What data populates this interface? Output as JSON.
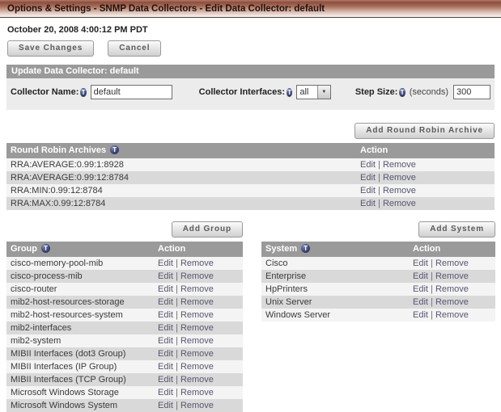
{
  "banner": {
    "title": "Options & Settings - SNMP Data Collectors - Edit Data Collector: default"
  },
  "timestamp": "October 20, 2008 4:00:12 PM PDT",
  "actions_bar": {
    "save": "Save Changes",
    "cancel": "Cancel"
  },
  "icons": {
    "tooltip_glyph": "T",
    "dropdown_arrow": "▼"
  },
  "update_form": {
    "title": "Update Data Collector: default",
    "fields": {
      "collector_name": {
        "label": "Collector Name:",
        "value": "default"
      },
      "collector_interfaces": {
        "label": "Collector Interfaces:",
        "selected": "all"
      },
      "step_size": {
        "label": "Step Size:",
        "unit": "(seconds)",
        "value": "300"
      }
    }
  },
  "row_actions": {
    "edit": "Edit",
    "remove": "Remove",
    "separator": "|"
  },
  "rra": {
    "add_button": "Add Round Robin Archive",
    "column_headers": {
      "name": "Round Robin Archives",
      "action": "Action"
    },
    "rows": [
      "RRA:AVERAGE:0.99:1:8928",
      "RRA:AVERAGE:0.99:12:8784",
      "RRA:MIN:0.99:12:8784",
      "RRA:MAX:0.99:12:8784"
    ]
  },
  "groups": {
    "add_button": "Add Group",
    "column_headers": {
      "name": "Group",
      "action": "Action"
    },
    "rows": [
      "cisco-memory-pool-mib",
      "cisco-process-mib",
      "cisco-router",
      "mib2-host-resources-storage",
      "mib2-host-resources-system",
      "mib2-interfaces",
      "mib2-system",
      "MIBII Interfaces (dot3 Group)",
      "MIBII Interfaces (IP Group)",
      "MIBII Interfaces (TCP Group)",
      "Microsoft Windows Storage",
      "Microsoft Windows System"
    ]
  },
  "systems": {
    "add_button": "Add System",
    "column_headers": {
      "name": "System",
      "action": "Action"
    },
    "rows": [
      "Cisco",
      "Enterprise",
      "HpPrinters",
      "Unix Server",
      "Windows Server"
    ]
  },
  "colors": {
    "banner_top": "#8e4e3d",
    "section_header": "#9a9a9a",
    "row_odd": "#f4f4f4",
    "row_even": "#d9d9d9",
    "link": "#575770",
    "form_bg": "#ececec"
  }
}
